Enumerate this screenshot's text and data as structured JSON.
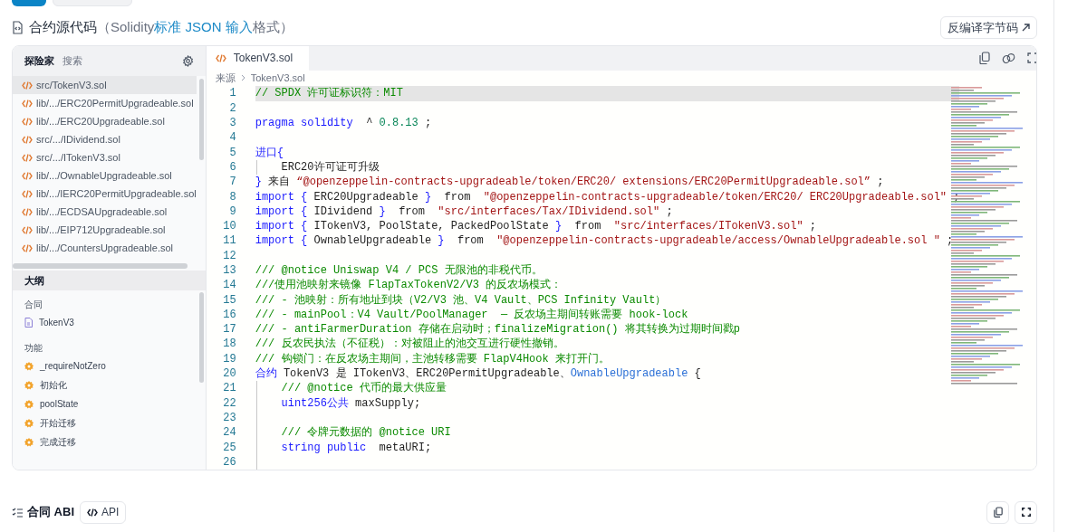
{
  "header": {
    "title": "合约源代码",
    "note_before": "（Solidity",
    "note_link": "标准 JSON 输入",
    "note_after": "格式）",
    "decompile_button": "反编译字节码"
  },
  "explorer": {
    "tabs": [
      {
        "label": "探险家",
        "selected": true
      },
      {
        "label": "搜索",
        "selected": false
      }
    ],
    "files": [
      {
        "label": "src/TokenV3.sol",
        "selected": true
      },
      {
        "label": "lib/.../ERC20PermitUpgradeable.sol",
        "selected": false
      },
      {
        "label": "lib/.../ERC20Upgradeable.sol",
        "selected": false
      },
      {
        "label": "src/.../IDividend.sol",
        "selected": false
      },
      {
        "label": "src/.../ITokenV3.sol",
        "selected": false
      },
      {
        "label": "lib/.../OwnableUpgradeable.sol",
        "selected": false
      },
      {
        "label": "lib/.../IERC20PermitUpgradeable.sol",
        "selected": false
      },
      {
        "label": "lib/.../ECDSAUpgradeable.sol",
        "selected": false
      },
      {
        "label": "lib/.../EIP712Upgradeable.sol",
        "selected": false
      },
      {
        "label": "lib/.../CountersUpgradeable.sol",
        "selected": false
      }
    ]
  },
  "outline": {
    "title": "大纲",
    "groups": [
      {
        "label": "合同",
        "items": [
          {
            "kind": "contract",
            "label": "TokenV3"
          }
        ]
      },
      {
        "label": "功能",
        "items": [
          {
            "kind": "function",
            "label": "_requireNotZero"
          },
          {
            "kind": "function",
            "label": "初始化"
          },
          {
            "kind": "function",
            "label": "poolState"
          },
          {
            "kind": "function",
            "label": "开始迁移"
          },
          {
            "kind": "function",
            "label": "完成迁移"
          }
        ]
      }
    ]
  },
  "editor": {
    "tabs": [
      {
        "label": "TokenV3.sol",
        "selected": true
      }
    ],
    "breadcrumb": [
      "来源",
      "TokenV3.sol"
    ],
    "lines": [
      {
        "number": "1",
        "highlighted": true,
        "indent_guide": false,
        "tokens": [
          {
            "kind": "comment",
            "text": "// SPDX 许可证标识符：MIT"
          }
        ]
      },
      {
        "number": "2",
        "highlighted": false,
        "indent_guide": false
      },
      {
        "number": "3",
        "highlighted": false,
        "indent_guide": false,
        "tokens": [
          {
            "kind": "keyword",
            "text": "pragma solidity"
          },
          {
            "kind": "plain",
            "text": "  ^ "
          },
          {
            "kind": "number",
            "text": "0.8.13"
          },
          {
            "kind": "plain",
            "text": " ;"
          }
        ]
      },
      {
        "number": "4",
        "highlighted": false,
        "indent_guide": false
      },
      {
        "number": "5",
        "highlighted": false,
        "indent_guide": false,
        "tokens": [
          {
            "kind": "keyword",
            "text": "进口{"
          }
        ]
      },
      {
        "number": "6",
        "highlighted": false,
        "indent_guide": true,
        "tokens": [
          {
            "kind": "plain",
            "text": "    ERC20许可证可升级"
          }
        ]
      },
      {
        "number": "7",
        "highlighted": false,
        "indent_guide": false,
        "tokens": [
          {
            "kind": "keyword",
            "text": "}"
          },
          {
            "kind": "plain",
            "text": " 来自 "
          },
          {
            "kind": "string",
            "text": "“@openzeppelin-contracts-upgradeable/token/ERC20/ extensions/ERC20PermitUpgradeable.sol”"
          },
          {
            "kind": "plain",
            "text": " ;"
          }
        ]
      },
      {
        "number": "8",
        "highlighted": false,
        "indent_guide": false,
        "tokens": [
          {
            "kind": "keyword",
            "text": "import {"
          },
          {
            "kind": "plain",
            "text": " ERC20Upgradeable "
          },
          {
            "kind": "keyword",
            "text": "}"
          },
          {
            "kind": "plain",
            "text": "  from  "
          },
          {
            "kind": "string",
            "text": "\"@openzeppelin-contracts-upgradeable/token/ERC20/ ERC20Upgradeable.sol\""
          },
          {
            "kind": "plain",
            "text": " ;"
          }
        ]
      },
      {
        "number": "9",
        "highlighted": false,
        "indent_guide": false,
        "tokens": [
          {
            "kind": "keyword",
            "text": "import {"
          },
          {
            "kind": "plain",
            "text": " IDividend "
          },
          {
            "kind": "keyword",
            "text": "}"
          },
          {
            "kind": "plain",
            "text": "  from  "
          },
          {
            "kind": "string",
            "text": "\"src/interfaces/Tax/IDividend.sol\""
          },
          {
            "kind": "plain",
            "text": " ;"
          }
        ]
      },
      {
        "number": "10",
        "highlighted": false,
        "indent_guide": false,
        "tokens": [
          {
            "kind": "keyword",
            "text": "import {"
          },
          {
            "kind": "plain",
            "text": " ITokenV3, PoolState, PackedPoolState "
          },
          {
            "kind": "keyword",
            "text": "}"
          },
          {
            "kind": "plain",
            "text": "  from  "
          },
          {
            "kind": "string",
            "text": "\"src/interfaces/ITokenV3.sol\""
          },
          {
            "kind": "plain",
            "text": " ;"
          }
        ]
      },
      {
        "number": "11",
        "highlighted": false,
        "indent_guide": false,
        "tokens": [
          {
            "kind": "keyword",
            "text": "import {"
          },
          {
            "kind": "plain",
            "text": " OwnableUpgradeable "
          },
          {
            "kind": "keyword",
            "text": "}"
          },
          {
            "kind": "plain",
            "text": "  from  "
          },
          {
            "kind": "string",
            "text": "\"@openzeppelin-contracts-upgradeable/access/OwnableUpgradeable.sol \""
          },
          {
            "kind": "plain",
            "text": " ;"
          }
        ]
      },
      {
        "number": "12",
        "highlighted": false,
        "indent_guide": false
      },
      {
        "number": "13",
        "highlighted": false,
        "indent_guide": false,
        "tokens": [
          {
            "kind": "comment",
            "text": "/// @notice Uniswap V4 / PCS 无限池的非税代币。"
          }
        ]
      },
      {
        "number": "14",
        "highlighted": false,
        "indent_guide": false,
        "tokens": [
          {
            "kind": "comment",
            "text": "///使用池映射来镜像 FlapTaxTokenV2/V3 的反农场模式："
          }
        ]
      },
      {
        "number": "15",
        "highlighted": false,
        "indent_guide": false,
        "tokens": [
          {
            "kind": "comment",
            "text": "/// - 池映射：所有地址到块（V2/V3 池、V4 Vault、PCS Infinity Vault）"
          }
        ]
      },
      {
        "number": "16",
        "highlighted": false,
        "indent_guide": false,
        "tokens": [
          {
            "kind": "comment",
            "text": "/// - mainPool：V4 Vault/PoolManager  — 反农场主期间转账需要 hook-lock"
          }
        ]
      },
      {
        "number": "17",
        "highlighted": false,
        "indent_guide": false,
        "tokens": [
          {
            "kind": "comment",
            "text": "/// - antiFarmerDuration 存储在启动时；finalizeMigration() 将其转换为过期时间戳p"
          }
        ]
      },
      {
        "number": "18",
        "highlighted": false,
        "indent_guide": false,
        "tokens": [
          {
            "kind": "comment",
            "text": "/// 反农民执法（不征税）：对被阻止的池交互进行硬性撤销。"
          }
        ]
      },
      {
        "number": "19",
        "highlighted": false,
        "indent_guide": false,
        "tokens": [
          {
            "kind": "comment",
            "text": "/// 钩锁门：在反农场主期间，主池转移需要 FlapV4Hook 来打开门。"
          }
        ]
      },
      {
        "number": "20",
        "highlighted": false,
        "indent_guide": false,
        "tokens": [
          {
            "kind": "keyword",
            "text": "合约"
          },
          {
            "kind": "plain",
            "text": " TokenV3 是 ITokenV3、ERC20PermitUpgradeable、"
          },
          {
            "kind": "type",
            "text": "OwnableUpgradeable"
          },
          {
            "kind": "plain",
            "text": " {"
          }
        ]
      },
      {
        "number": "21",
        "highlighted": false,
        "indent_guide": true,
        "tokens": [
          {
            "kind": "comment",
            "text": "    /// @notice 代币的最大供应量"
          }
        ]
      },
      {
        "number": "22",
        "highlighted": false,
        "indent_guide": true,
        "tokens": [
          {
            "kind": "keyword",
            "text": "    uint256公共"
          },
          {
            "kind": "plain",
            "text": " maxSupply;"
          }
        ]
      },
      {
        "number": "23",
        "highlighted": false,
        "indent_guide": true
      },
      {
        "number": "24",
        "highlighted": false,
        "indent_guide": true,
        "tokens": [
          {
            "kind": "comment",
            "text": "    /// 令牌元数据的 @notice URI"
          }
        ]
      },
      {
        "number": "25",
        "highlighted": false,
        "indent_guide": true,
        "tokens": [
          {
            "kind": "keyword",
            "text": "    string public"
          },
          {
            "kind": "plain",
            "text": "  metaURI;"
          }
        ]
      },
      {
        "number": "26",
        "highlighted": false,
        "indent_guide": true
      }
    ]
  },
  "abi": {
    "title": "合同 ABI",
    "api_button": "API"
  }
}
